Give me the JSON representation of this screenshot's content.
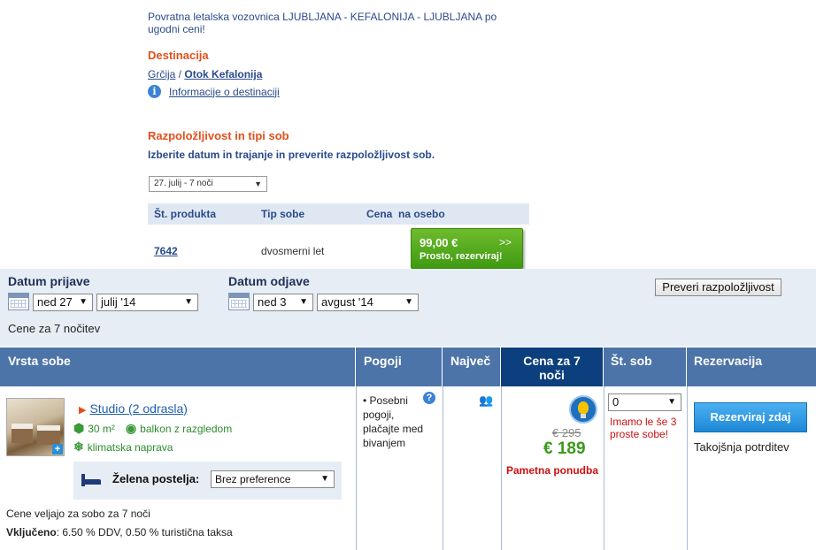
{
  "offer": {
    "intro": "Povratna letalska vozovnica LJUBLJANA - KEFALONIJA - LJUBLJANA po ugodni ceni!",
    "destination_title": "Destinacija",
    "breadcrumb_country": "Grčija",
    "breadcrumb_sep": " / ",
    "breadcrumb_region": "Otok Kefalonija",
    "info_link": "Informacije o destinaciji",
    "availability_title": "Razpoložljivost in tipi sob",
    "availability_subtitle": "Izberite datum in trajanje in preverite razpoložljivost sob.",
    "date_select": "27. julij - 7 noči",
    "table_headers": {
      "code": "Št. produkta",
      "type": "Tip sobe",
      "price": "Cena  na osebo"
    },
    "row": {
      "code": "7642",
      "type": "dvosmerni let",
      "price": "99,00 €",
      "arrows": ">>",
      "button_label": "Prosto, rezerviraj!"
    }
  },
  "search": {
    "checkin_label": "Datum prijave",
    "checkin_day": "ned 27",
    "checkin_month": "julij '14",
    "checkout_label": "Datum odjave",
    "checkout_day": "ned 3",
    "checkout_month": "avgust '14",
    "check_button": "Preveri razpoložljivost",
    "price_note": "Cene za 7 nočitev"
  },
  "rooms_table": {
    "headers": {
      "room_type": "Vrsta sobe",
      "conditions": "Pogoji",
      "max": "Največ",
      "price": "Cena za 7 noči",
      "rooms": "Št. sob",
      "booking": "Rezervacija"
    },
    "room": {
      "name": "Studio (2 odrasla)",
      "size": "30 m²",
      "balcony": "balkon z razgledom",
      "ac": "klimatska naprava",
      "bed_label": "Želena postelja:",
      "bed_option": "Brez preference",
      "valid_note": "Cene veljajo za sobo za 7 noči",
      "included_label": "Vključeno",
      "included_text": ": 6.50 % DDV, 0.50 % turistična taksa",
      "conditions": "• Posebni pogoji, plačajte med bivanjem",
      "old_price": "€ 295",
      "new_price": "€ 189",
      "smart_offer": "Pametna ponudba",
      "rooms_value": "0",
      "rooms_warning": "Imamo le še 3 proste sobe!",
      "book_button": "Rezerviraj zdaj",
      "instant_confirm": "Takojšnja potrditev"
    }
  }
}
